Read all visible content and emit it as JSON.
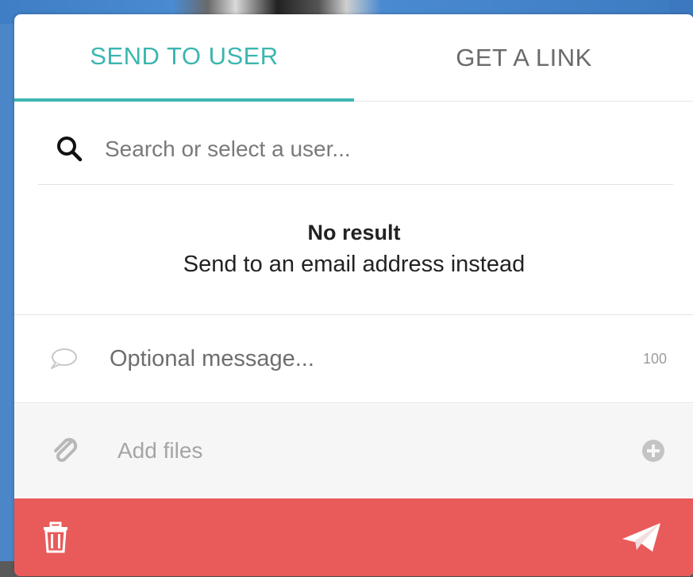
{
  "tabs": [
    {
      "label": "SEND TO USER",
      "active": true
    },
    {
      "label": "GET A LINK",
      "active": false
    }
  ],
  "search": {
    "placeholder": "Search or select a user...",
    "icon": "search-icon"
  },
  "no_result": {
    "title": "No result",
    "action": "Send to an email address instead"
  },
  "message": {
    "placeholder": "Optional message...",
    "char_limit": "100",
    "icon": "speech-bubble-icon"
  },
  "files": {
    "label": "Add files",
    "icon": "paperclip-icon",
    "add_icon": "plus-circle-icon"
  },
  "footer": {
    "delete_icon": "trash-icon",
    "send_icon": "paper-plane-icon"
  },
  "colors": {
    "accent": "#3bb6b0",
    "footer": "#e85b5a",
    "inactive_tab": "#6b6b6b"
  }
}
